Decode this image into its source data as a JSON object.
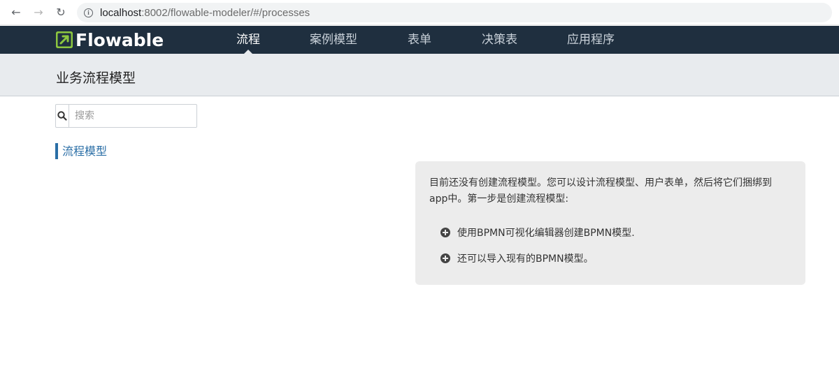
{
  "browser": {
    "back_icon": "←",
    "forward_icon": "→",
    "reload_icon": "↻",
    "url_host": "localhost",
    "url_path": ":8002/flowable-modeler/#/processes"
  },
  "app": {
    "brand": "Flowable",
    "nav": [
      {
        "label": "流程",
        "active": true
      },
      {
        "label": "案例模型"
      },
      {
        "label": "表单"
      },
      {
        "label": "决策表"
      },
      {
        "label": "应用程序"
      }
    ]
  },
  "page": {
    "title": "业务流程模型",
    "search_placeholder": "搜索",
    "filter_label": "流程模型"
  },
  "help": {
    "intro": "目前还没有创建流程模型。您可以设计流程模型、用户表单，然后将它们捆绑到app中。第一步是创建流程模型:",
    "items": [
      "使用BPMN可视化编辑器创建BPMN模型.",
      "还可以导入现有的BPMN模型。"
    ]
  },
  "colors": {
    "navbar": "#1f2f3f",
    "accent": "#2a6ea6",
    "logo_green": "#8cc63f"
  }
}
